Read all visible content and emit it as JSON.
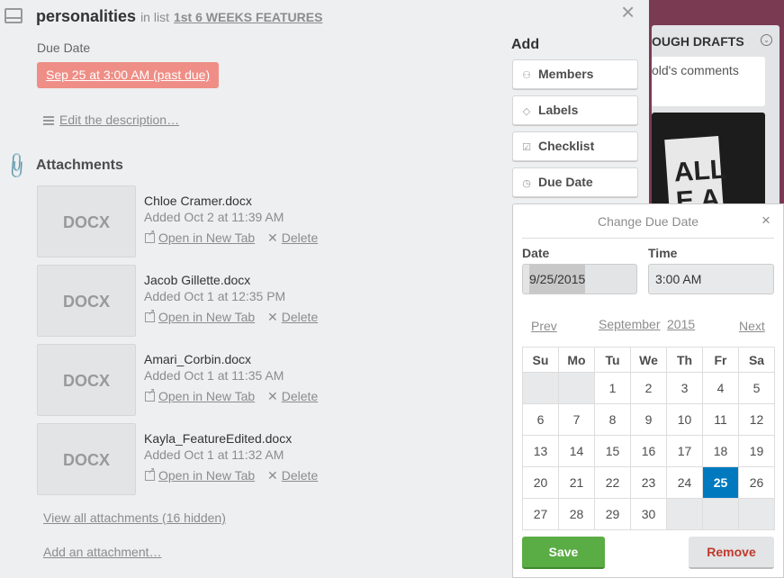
{
  "background": {
    "list_title": "OUGH DRAFTS",
    "card_text": "old's comments",
    "image_text": "ALL\nE A"
  },
  "card": {
    "title": "personalities",
    "in_list_prefix": "in list",
    "list_name": "1st 6 WEEKS FEATURES",
    "close_glyph": "×",
    "due_label": "Due Date",
    "due_value": "Sep 25 at 3:00 AM (past due)",
    "description_link": "Edit the description…",
    "attachments_heading": "Attachments",
    "attachments": [
      {
        "thumb": "DOCX",
        "name": "Chloe Cramer.docx",
        "added": "Added Oct 2 at 11:39 AM",
        "open": "Open in New Tab",
        "delete": "Delete"
      },
      {
        "thumb": "DOCX",
        "name": "Jacob Gillette.docx",
        "added": "Added Oct 1 at 12:35 PM",
        "open": "Open in New Tab",
        "delete": "Delete"
      },
      {
        "thumb": "DOCX",
        "name": "Amari_Corbin.docx",
        "added": "Added Oct 1 at 11:35 AM",
        "open": "Open in New Tab",
        "delete": "Delete"
      },
      {
        "thumb": "DOCX",
        "name": "Kayla_FeatureEdited.docx",
        "added": "Added Oct 1 at 11:32 AM",
        "open": "Open in New Tab",
        "delete": "Delete"
      }
    ],
    "view_all": "View all attachments (16 hidden)",
    "add_attachment": "Add an attachment…"
  },
  "sidebar": {
    "heading": "Add",
    "buttons": [
      {
        "label": "Members",
        "icon": "person-icon"
      },
      {
        "label": "Labels",
        "icon": "tag-icon"
      },
      {
        "label": "Checklist",
        "icon": "checkbox-icon"
      },
      {
        "label": "Due Date",
        "icon": "clock-icon"
      }
    ]
  },
  "due_popover": {
    "title": "Change Due Date",
    "close_glyph": "×",
    "date_label": "Date",
    "time_label": "Time",
    "date_value": "9/25/2015",
    "time_value": "3:00 AM",
    "prev": "Prev",
    "next": "Next",
    "month": "September",
    "year": "2015",
    "weekdays": [
      "Su",
      "Mo",
      "Tu",
      "We",
      "Th",
      "Fr",
      "Sa"
    ],
    "weeks": [
      [
        "",
        "",
        "1",
        "2",
        "3",
        "4",
        "5"
      ],
      [
        "6",
        "7",
        "8",
        "9",
        "10",
        "11",
        "12"
      ],
      [
        "13",
        "14",
        "15",
        "16",
        "17",
        "18",
        "19"
      ],
      [
        "20",
        "21",
        "22",
        "23",
        "24",
        "25",
        "26"
      ],
      [
        "27",
        "28",
        "29",
        "30",
        "",
        "",
        ""
      ]
    ],
    "selected_day": "25",
    "save": "Save",
    "remove": "Remove"
  },
  "colors": {
    "due_badge": "#ef8e86",
    "save": "#5aac44",
    "selected_day": "#0079bf",
    "remove_text": "#c0392b"
  }
}
